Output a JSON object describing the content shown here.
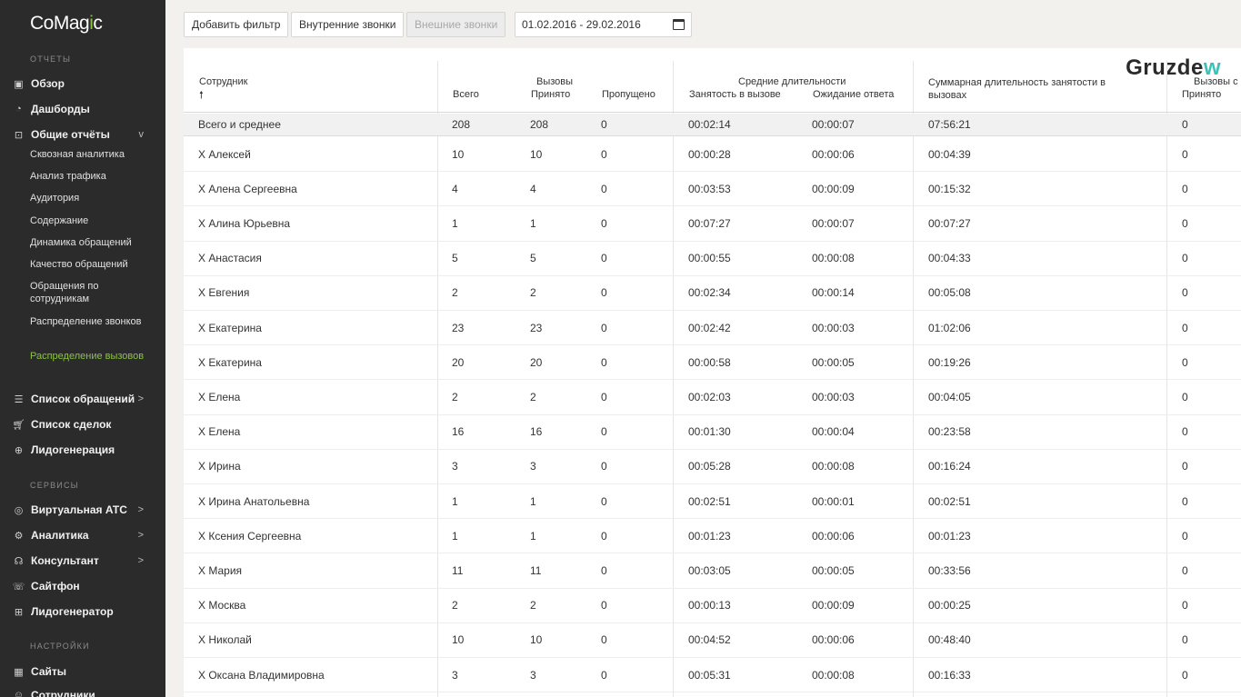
{
  "sidebar": {
    "logo": {
      "part1": "Co",
      "part2": "Mag",
      "part3": "i",
      "part4": "c"
    },
    "sections": {
      "reports": "ОТЧЕТЫ",
      "services": "СЕРВИСЫ",
      "settings": "НАСТРОЙКИ"
    },
    "items": {
      "overview": "Обзор",
      "dashboards": "Дашборды",
      "general_reports": "Общие отчёты",
      "call_list": "Список обращений",
      "deal_list": "Список сделок",
      "leadgen": "Лидогенерация",
      "virtual_pbx": "Виртуальная АТС",
      "analytics": "Аналитика",
      "consultant": "Консультант",
      "sitephone": "Сайтфон",
      "leadgenerator": "Лидогенератор",
      "sites": "Сайты",
      "employees": "Сотрудники"
    },
    "chevrons": {
      "open": "v",
      "closed": ">"
    },
    "subitems": [
      "Сквозная аналитика",
      "Анализ трафика",
      "Аудитория",
      "Содержание",
      "Динамика обращений",
      "Качество обращений",
      "Обращения по сотрудникам",
      "Распределение звонков",
      "Распределение вызовов"
    ]
  },
  "toolbar": {
    "add_filter": "Добавить фильтр",
    "internal_calls": "Внутренние звонки",
    "external_calls": "Внешние звонки",
    "date_range": "01.02.2016 - 29.02.2016"
  },
  "watermark": {
    "text": "Gruzde",
    "accent": "w"
  },
  "table": {
    "headers": {
      "employee": "Сотрудник",
      "sort_arrow": "🠕",
      "calls_group": "Вызовы",
      "total": "Всего",
      "accepted": "Принято",
      "missed": "Пропущено",
      "avg_group": "Средние длительности",
      "busy": "Занятость в вызове",
      "waiting": "Ожидание ответа",
      "sum_busy": "Суммарная длительность занятости в вызовах",
      "calls_with": "Вызовы с",
      "accepted2": "Принято"
    },
    "total_row": {
      "name": "Всего и среднее",
      "total": "208",
      "accepted": "208",
      "missed": "0",
      "busy": "00:02:14",
      "waiting": "00:00:07",
      "sum": "07:56:21",
      "extra": "0"
    },
    "rows": [
      {
        "name": "X Алексей",
        "total": "10",
        "accepted": "10",
        "missed": "0",
        "busy": "00:00:28",
        "waiting": "00:00:06",
        "sum": "00:04:39",
        "extra": "0"
      },
      {
        "name": "X Алена Сергеевна",
        "total": "4",
        "accepted": "4",
        "missed": "0",
        "busy": "00:03:53",
        "waiting": "00:00:09",
        "sum": "00:15:32",
        "extra": "0"
      },
      {
        "name": "X Алина Юрьевна",
        "total": "1",
        "accepted": "1",
        "missed": "0",
        "busy": "00:07:27",
        "waiting": "00:00:07",
        "sum": "00:07:27",
        "extra": "0"
      },
      {
        "name": "X Анастасия",
        "total": "5",
        "accepted": "5",
        "missed": "0",
        "busy": "00:00:55",
        "waiting": "00:00:08",
        "sum": "00:04:33",
        "extra": "0"
      },
      {
        "name": "X Евгения",
        "total": "2",
        "accepted": "2",
        "missed": "0",
        "busy": "00:02:34",
        "waiting": "00:00:14",
        "sum": "00:05:08",
        "extra": "0"
      },
      {
        "name": "X Екатерина",
        "total": "23",
        "accepted": "23",
        "missed": "0",
        "busy": "00:02:42",
        "waiting": "00:00:03",
        "sum": "01:02:06",
        "extra": "0"
      },
      {
        "name": "X Екатерина",
        "total": "20",
        "accepted": "20",
        "missed": "0",
        "busy": "00:00:58",
        "waiting": "00:00:05",
        "sum": "00:19:26",
        "extra": "0"
      },
      {
        "name": "X Елена",
        "total": "2",
        "accepted": "2",
        "missed": "0",
        "busy": "00:02:03",
        "waiting": "00:00:03",
        "sum": "00:04:05",
        "extra": "0"
      },
      {
        "name": "X Елена",
        "total": "16",
        "accepted": "16",
        "missed": "0",
        "busy": "00:01:30",
        "waiting": "00:00:04",
        "sum": "00:23:58",
        "extra": "0"
      },
      {
        "name": "X Ирина",
        "total": "3",
        "accepted": "3",
        "missed": "0",
        "busy": "00:05:28",
        "waiting": "00:00:08",
        "sum": "00:16:24",
        "extra": "0"
      },
      {
        "name": "X Ирина Анатольевна",
        "total": "1",
        "accepted": "1",
        "missed": "0",
        "busy": "00:02:51",
        "waiting": "00:00:01",
        "sum": "00:02:51",
        "extra": "0"
      },
      {
        "name": "X Ксения Сергеевна",
        "total": "1",
        "accepted": "1",
        "missed": "0",
        "busy": "00:01:23",
        "waiting": "00:00:06",
        "sum": "00:01:23",
        "extra": "0"
      },
      {
        "name": "X Мария",
        "total": "11",
        "accepted": "11",
        "missed": "0",
        "busy": "00:03:05",
        "waiting": "00:00:05",
        "sum": "00:33:56",
        "extra": "0"
      },
      {
        "name": "X Москва",
        "total": "2",
        "accepted": "2",
        "missed": "0",
        "busy": "00:00:13",
        "waiting": "00:00:09",
        "sum": "00:00:25",
        "extra": "0"
      },
      {
        "name": "X Николай",
        "total": "10",
        "accepted": "10",
        "missed": "0",
        "busy": "00:04:52",
        "waiting": "00:00:06",
        "sum": "00:48:40",
        "extra": "0"
      },
      {
        "name": "X Оксана Владимировна",
        "total": "3",
        "accepted": "3",
        "missed": "0",
        "busy": "00:05:31",
        "waiting": "00:00:08",
        "sum": "00:16:33",
        "extra": "0"
      }
    ]
  }
}
